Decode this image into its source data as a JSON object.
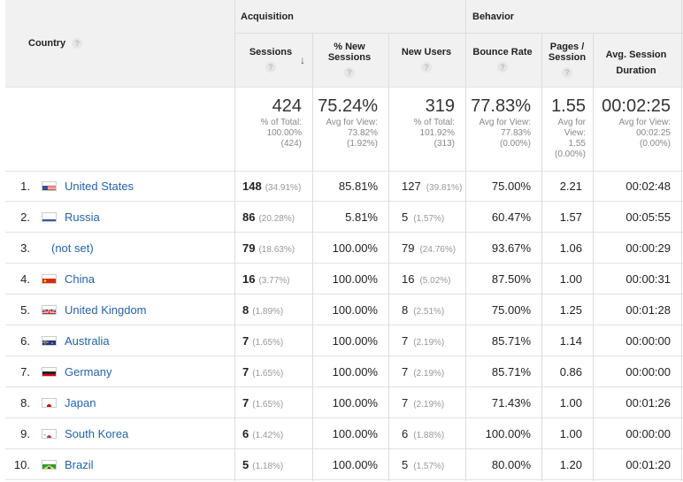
{
  "header": {
    "country_label": "Country",
    "acquisition_label": "Acquisition",
    "behavior_label": "Behavior",
    "help_glyph": "?",
    "columns": {
      "sessions": "Sessions",
      "new_sessions": "% New Sessions",
      "new_users": "New Users",
      "bounce_rate": "Bounce Rate",
      "pages_session": "Pages / Session",
      "avg_duration": "Avg. Session Duration"
    }
  },
  "totals": {
    "sessions": {
      "value": "424",
      "l1": "% of Total:",
      "l2": "100.00%",
      "l3": "(424)"
    },
    "new_sessions": {
      "value": "75.24%",
      "l1": "Avg for View:",
      "l2": "73.82%",
      "l3": "(1.92%)"
    },
    "new_users": {
      "value": "319",
      "l1": "% of Total:",
      "l2": "101.92%",
      "l3": "(313)"
    },
    "bounce_rate": {
      "value": "77.83%",
      "l1": "Avg for View:",
      "l2": "77.83%",
      "l3": "(0.00%)"
    },
    "pages_session": {
      "value": "1.55",
      "l1": "Avg for",
      "l2": "View:",
      "l3": "1.55",
      "l4": "(0.00%)"
    },
    "avg_duration": {
      "value": "00:02:25",
      "l1": "Avg for View:",
      "l2": "00:02:25",
      "l3": "(0.00%)"
    }
  },
  "rows": [
    {
      "rank": "1.",
      "country": "United States",
      "flag": "us-flag-icon",
      "sessions": "148",
      "sessions_pct": "(34.91%)",
      "new_sessions": "85.81%",
      "new_users": "127",
      "new_users_pct": "(39.81%)",
      "bounce_rate": "75.00%",
      "pages_session": "2.21",
      "avg_duration": "00:02:48"
    },
    {
      "rank": "2.",
      "country": "Russia",
      "flag": "ru-flag-icon",
      "sessions": "86",
      "sessions_pct": "(20.28%)",
      "new_sessions": "5.81%",
      "new_users": "5",
      "new_users_pct": "(1.57%)",
      "bounce_rate": "60.47%",
      "pages_session": "1.57",
      "avg_duration": "00:05:55"
    },
    {
      "rank": "3.",
      "country": "(not set)",
      "flag": "",
      "sessions": "79",
      "sessions_pct": "(18.63%)",
      "new_sessions": "100.00%",
      "new_users": "79",
      "new_users_pct": "(24.76%)",
      "bounce_rate": "93.67%",
      "pages_session": "1.06",
      "avg_duration": "00:00:29"
    },
    {
      "rank": "4.",
      "country": "China",
      "flag": "cn-flag-icon",
      "sessions": "16",
      "sessions_pct": "(3.77%)",
      "new_sessions": "100.00%",
      "new_users": "16",
      "new_users_pct": "(5.02%)",
      "bounce_rate": "87.50%",
      "pages_session": "1.00",
      "avg_duration": "00:00:31"
    },
    {
      "rank": "5.",
      "country": "United Kingdom",
      "flag": "gb-flag-icon",
      "sessions": "8",
      "sessions_pct": "(1.89%)",
      "new_sessions": "100.00%",
      "new_users": "8",
      "new_users_pct": "(2.51%)",
      "bounce_rate": "75.00%",
      "pages_session": "1.25",
      "avg_duration": "00:01:28"
    },
    {
      "rank": "6.",
      "country": "Australia",
      "flag": "au-flag-icon",
      "sessions": "7",
      "sessions_pct": "(1.65%)",
      "new_sessions": "100.00%",
      "new_users": "7",
      "new_users_pct": "(2.19%)",
      "bounce_rate": "85.71%",
      "pages_session": "1.14",
      "avg_duration": "00:00:00"
    },
    {
      "rank": "7.",
      "country": "Germany",
      "flag": "de-flag-icon",
      "sessions": "7",
      "sessions_pct": "(1.65%)",
      "new_sessions": "100.00%",
      "new_users": "7",
      "new_users_pct": "(2.19%)",
      "bounce_rate": "85.71%",
      "pages_session": "0.86",
      "avg_duration": "00:00:00"
    },
    {
      "rank": "8.",
      "country": "Japan",
      "flag": "jp-flag-icon",
      "sessions": "7",
      "sessions_pct": "(1.65%)",
      "new_sessions": "100.00%",
      "new_users": "7",
      "new_users_pct": "(2.19%)",
      "bounce_rate": "71.43%",
      "pages_session": "1.00",
      "avg_duration": "00:01:26"
    },
    {
      "rank": "9.",
      "country": "South Korea",
      "flag": "kr-flag-icon",
      "sessions": "6",
      "sessions_pct": "(1.42%)",
      "new_sessions": "100.00%",
      "new_users": "6",
      "new_users_pct": "(1.88%)",
      "bounce_rate": "100.00%",
      "pages_session": "1.00",
      "avg_duration": "00:00:00"
    },
    {
      "rank": "10.",
      "country": "Brazil",
      "flag": "br-flag-icon",
      "sessions": "5",
      "sessions_pct": "(1.18%)",
      "new_sessions": "100.00%",
      "new_users": "5",
      "new_users_pct": "(1.57%)",
      "bounce_rate": "80.00%",
      "pages_session": "1.20",
      "avg_duration": "00:01:20"
    }
  ]
}
